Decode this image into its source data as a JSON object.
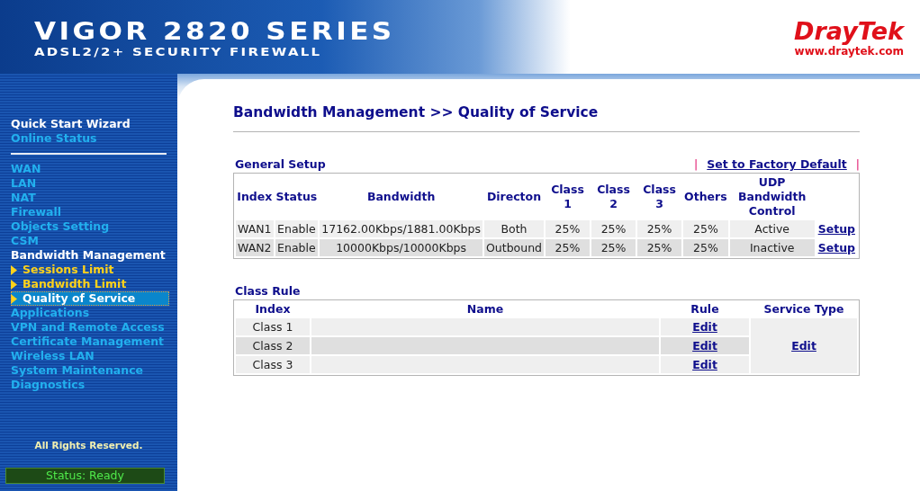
{
  "header": {
    "product": "VIGOR 2820 SERIES",
    "subtitle": "ADSL2/2+ SECURITY FIREWALL",
    "brand": "DrayTek",
    "website": "www.draytek.com"
  },
  "sidebar": {
    "top_items": [
      {
        "label": "Quick Start Wizard",
        "kind": "heading",
        "selected": false
      },
      {
        "label": "Online Status",
        "kind": "link",
        "selected": false
      }
    ],
    "items": [
      {
        "label": "WAN",
        "kind": "link",
        "selected": false
      },
      {
        "label": "LAN",
        "kind": "link",
        "selected": false
      },
      {
        "label": "NAT",
        "kind": "link",
        "selected": false
      },
      {
        "label": "Firewall",
        "kind": "link",
        "selected": false
      },
      {
        "label": "Objects Setting",
        "kind": "link",
        "selected": false
      },
      {
        "label": "CSM",
        "kind": "link",
        "selected": false
      },
      {
        "label": "Bandwidth Management",
        "kind": "heading",
        "selected": false
      },
      {
        "label": "Sessions Limit",
        "kind": "sub",
        "selected": false
      },
      {
        "label": "Bandwidth Limit",
        "kind": "sub",
        "selected": false
      },
      {
        "label": "Quality of Service",
        "kind": "sub",
        "selected": true
      },
      {
        "label": "Applications",
        "kind": "link",
        "selected": false
      },
      {
        "label": "VPN and Remote Access",
        "kind": "link",
        "selected": false
      },
      {
        "label": "Certificate Management",
        "kind": "link",
        "selected": false
      },
      {
        "label": "Wireless LAN",
        "kind": "link",
        "selected": false
      },
      {
        "label": "System Maintenance",
        "kind": "link",
        "selected": false
      },
      {
        "label": "Diagnostics",
        "kind": "link",
        "selected": false
      }
    ],
    "copyright": "All Rights Reserved.",
    "status": "Status: Ready"
  },
  "page_title": "Bandwidth Management >> Quality of Service",
  "general_setup": {
    "title": "General Setup",
    "separator": "|",
    "factory_default": "Set to Factory Default",
    "columns": [
      "Index",
      "Status",
      "Bandwidth",
      "Directon",
      "Class 1",
      "Class 2",
      "Class 3",
      "Others",
      "UDP Bandwidth Control"
    ],
    "rows": [
      {
        "cells": [
          "WAN1",
          "Enable",
          "17162.00Kbps/1881.00Kbps",
          "Both",
          "25%",
          "25%",
          "25%",
          "25%",
          "Active"
        ],
        "action": "Setup"
      },
      {
        "cells": [
          "WAN2",
          "Enable",
          "10000Kbps/10000Kbps",
          "Outbound",
          "25%",
          "25%",
          "25%",
          "25%",
          "Inactive"
        ],
        "action": "Setup"
      }
    ]
  },
  "class_rule": {
    "title": "Class Rule",
    "columns": [
      "Index",
      "Name",
      "Rule",
      "Service Type"
    ],
    "rows": [
      {
        "index": "Class 1",
        "rule": "Edit"
      },
      {
        "index": "Class 2",
        "rule": "Edit"
      },
      {
        "index": "Class 3",
        "rule": "Edit"
      }
    ],
    "service_type": "Edit"
  }
}
